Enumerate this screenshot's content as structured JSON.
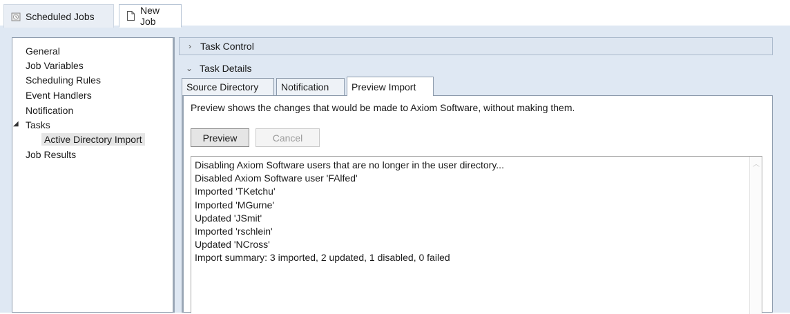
{
  "doc_tabs": [
    {
      "label": "Scheduled Jobs",
      "icon": "scheduled-jobs-icon",
      "active": false
    },
    {
      "label": "New Job",
      "icon": "document-icon",
      "active": true
    }
  ],
  "nav": {
    "items": [
      {
        "label": "General"
      },
      {
        "label": "Job Variables"
      },
      {
        "label": "Scheduling Rules"
      },
      {
        "label": "Event Handlers"
      },
      {
        "label": "Notification"
      },
      {
        "label": "Tasks",
        "expanded": true
      },
      {
        "label": "Active Directory Import",
        "selected": true
      },
      {
        "label": "Job Results"
      }
    ],
    "tasks_toggle": "◢"
  },
  "sections": {
    "task_control": {
      "label": "Task Control",
      "chevron": "›"
    },
    "task_details": {
      "label": "Task Details",
      "chevron": "⌄"
    }
  },
  "sub_tabs": [
    {
      "label": "Source Directory"
    },
    {
      "label": "Notification"
    },
    {
      "label": "Preview Import",
      "active": true
    }
  ],
  "preview": {
    "description": "Preview shows the changes that would be made to Axiom Software, without making them.",
    "preview_button": "Preview",
    "cancel_button": "Cancel",
    "log_lines": [
      "Disabling Axiom Software users that are no longer in the user directory...",
      "Disabled Axiom Software user 'FAlfed'",
      "Imported 'TKetchu'",
      "Imported 'MGurne'",
      "Updated 'JSmit'",
      "Imported 'rschlein'",
      "Updated 'NCross'",
      "Import summary: 3 imported, 2 updated, 1 disabled, 0 failed"
    ]
  },
  "colors": {
    "panel_bg": "#dfe8f3",
    "border": "#8c9aab"
  }
}
